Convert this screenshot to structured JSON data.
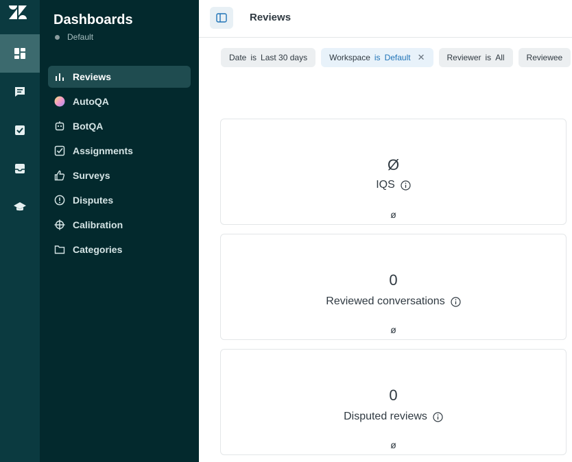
{
  "rail": {
    "items": [
      {
        "name": "dashboards",
        "icon": "dashboard-icon",
        "active": true
      },
      {
        "name": "conversations",
        "icon": "chat-icon",
        "active": false
      },
      {
        "name": "tasks",
        "icon": "checkbox-icon",
        "active": false
      },
      {
        "name": "inbox",
        "icon": "inbox-icon",
        "active": false
      },
      {
        "name": "training",
        "icon": "graduation-cap-icon",
        "active": false
      }
    ]
  },
  "sidebar": {
    "title": "Dashboards",
    "subtitle": "Default",
    "items": [
      {
        "label": "Reviews",
        "icon": "bar-chart-icon",
        "active": true
      },
      {
        "label": "AutoQA",
        "icon": "autoqa-gradient-icon",
        "active": false
      },
      {
        "label": "BotQA",
        "icon": "bot-icon",
        "active": false
      },
      {
        "label": "Assignments",
        "icon": "checkbox-icon",
        "active": false
      },
      {
        "label": "Surveys",
        "icon": "thumbs-up-icon",
        "active": false
      },
      {
        "label": "Disputes",
        "icon": "alert-circle-icon",
        "active": false
      },
      {
        "label": "Calibration",
        "icon": "crosshair-icon",
        "active": false
      },
      {
        "label": "Categories",
        "icon": "folder-icon",
        "active": false
      }
    ]
  },
  "header": {
    "title": "Reviews"
  },
  "filters": [
    {
      "field": "Date",
      "op": "is",
      "value": "Last 30 days",
      "removable": false
    },
    {
      "field": "Workspace",
      "op": "is",
      "value": "Default",
      "removable": true
    },
    {
      "field": "Reviewer",
      "op": "is",
      "value": "All",
      "removable": false
    },
    {
      "field": "Reviewee",
      "op": "",
      "value": "",
      "removable": false
    }
  ],
  "cards": [
    {
      "value": "Ø",
      "label": "IQS",
      "delta": "ø"
    },
    {
      "value": "0",
      "label": "Reviewed conversations",
      "delta": "ø"
    },
    {
      "value": "0",
      "label": "Disputed reviews",
      "delta": "ø"
    }
  ],
  "colors": {
    "rail_bg": "#0b3a40",
    "sidebar_bg": "#03292d",
    "active_nav": "#1f4c50",
    "accent_blue": "#1f73b7"
  }
}
